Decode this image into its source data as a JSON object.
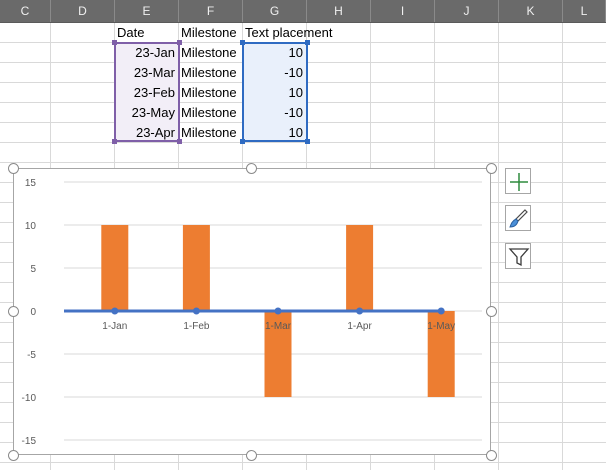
{
  "columns": [
    "C",
    "D",
    "E",
    "F",
    "G",
    "H",
    "I",
    "J",
    "K",
    "L"
  ],
  "table": {
    "headers": [
      "Date",
      "Milestone",
      "Text placement"
    ],
    "rows": [
      {
        "date": "23-Jan",
        "milestone": "Milestone",
        "placement": "10"
      },
      {
        "date": "23-Mar",
        "milestone": "Milestone",
        "placement": "-10"
      },
      {
        "date": "23-Feb",
        "milestone": "Milestone",
        "placement": "10"
      },
      {
        "date": "23-May",
        "milestone": "Milestone",
        "placement": "-10"
      },
      {
        "date": "23-Apr",
        "milestone": "Milestone",
        "placement": "10"
      }
    ]
  },
  "colors": {
    "bar": "#ed7d31",
    "line": "#4472c4",
    "purple_range": "#7f5fa8",
    "blue_range": "#2f6bc2",
    "column_header_bg": "#6a6a6a"
  },
  "chart_data": {
    "type": "bar",
    "categories": [
      "1-Jan",
      "1-Feb",
      "1-Mar",
      "1-Apr",
      "1-May"
    ],
    "series": [
      {
        "type": "bar",
        "values": [
          10,
          10,
          -10,
          10,
          -10
        ]
      },
      {
        "type": "line",
        "values": [
          0,
          0,
          0,
          0,
          0
        ]
      }
    ],
    "yticks": [
      "15",
      "10",
      "5",
      "0",
      "-5",
      "-10",
      "-15"
    ],
    "ylim": [
      -15,
      15
    ],
    "grid": true
  },
  "side_buttons": {
    "add": "plus-icon",
    "style": "brush-icon",
    "filter": "filter-icon"
  }
}
